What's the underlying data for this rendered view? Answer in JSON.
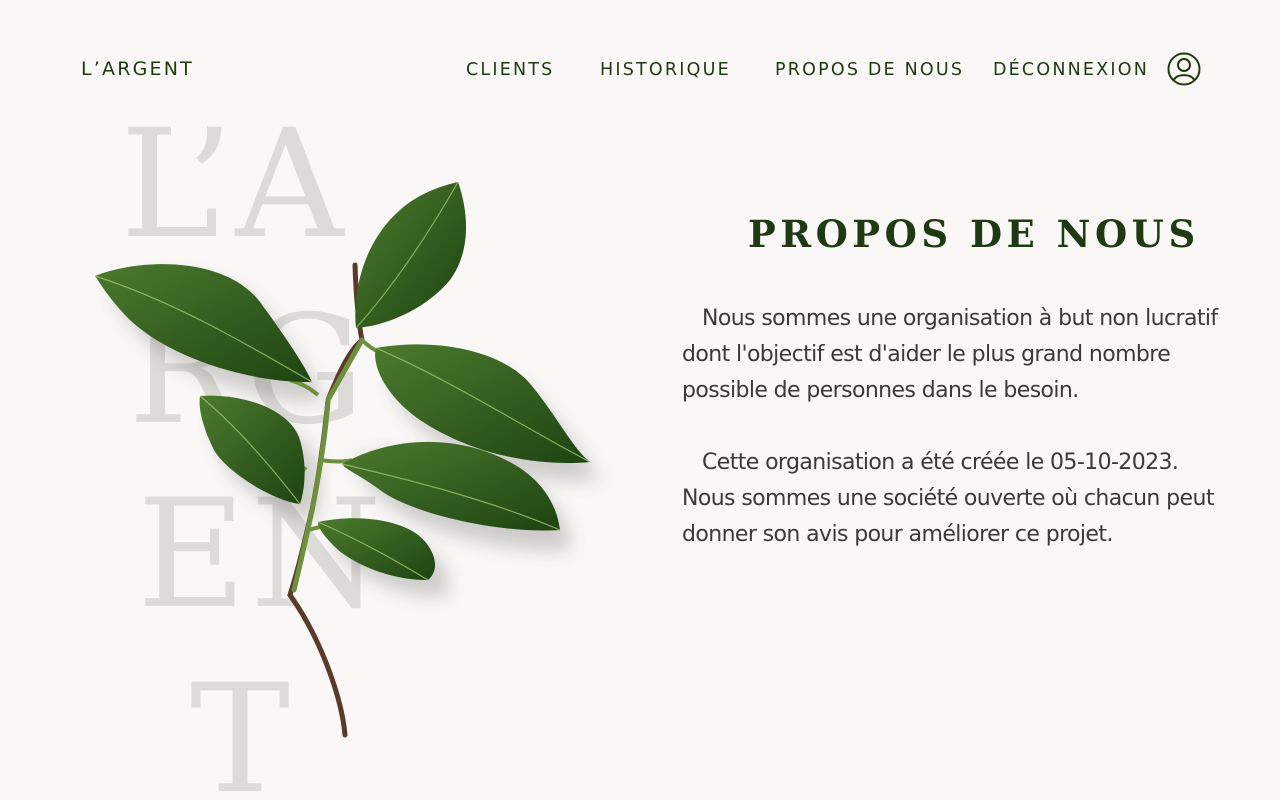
{
  "header": {
    "brand": "L’ARGENT",
    "nav": [
      "CLIENTS",
      "HISTORIQUE",
      "PROPOS DE NOUS",
      "DÉCONNEXION"
    ],
    "user_icon": "user-circle-icon"
  },
  "hero": {
    "background_letters": [
      "L’A",
      "RG",
      "EN",
      "T"
    ],
    "image": "green-leaf-branch"
  },
  "about": {
    "title": "PROPOS DE NOUS",
    "paragraphs": [
      "Nous sommes une organisation à but non lucratif dont l'objectif est d'aider le plus grand nombre possible de personnes dans le besoin.",
      "Cette organisation a été créée le 05-10-2023. Nous sommes une société ouverte où chacun peut donner son avis pour améliorer ce projet."
    ]
  },
  "colors": {
    "background": "#f9f8f6",
    "accent": "#1f3a12",
    "body_text": "#3a3a3a",
    "watermark": "#dcdbd8"
  }
}
